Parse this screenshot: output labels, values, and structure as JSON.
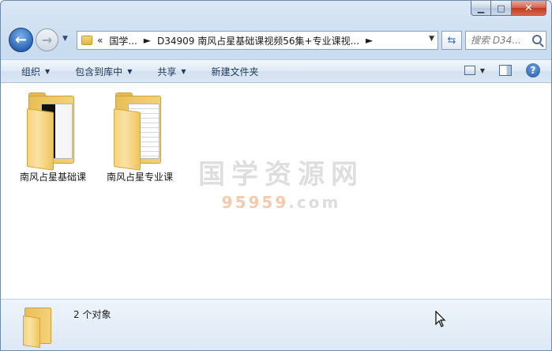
{
  "window": {
    "caption": {
      "minimize": "▁",
      "maximize": "□",
      "close": "✕"
    }
  },
  "nav": {
    "back_icon": "back-arrow-icon",
    "forward_icon": "forward-arrow-icon",
    "address": {
      "prefix": "«",
      "crumbs": [
        "国学...",
        "D34909 南风占星基础课视频56集+专业课视..."
      ],
      "sep": "►"
    },
    "search_placeholder": "搜索 D34..."
  },
  "toolbar": {
    "items": [
      "组织",
      "包含到库中",
      "共享",
      "新建文件夹"
    ]
  },
  "content": {
    "items": [
      {
        "label": "南风占星基础课",
        "type": "folder"
      },
      {
        "label": "南风占星专业课",
        "type": "folder"
      }
    ],
    "watermark": {
      "title": "国学资源网",
      "url_pre": "",
      "url_num": "95959",
      "url_post": ".com"
    }
  },
  "status": {
    "count_text": "2 个对象"
  },
  "colors": {
    "accent": "#2a66b4",
    "folder": "#f3d27a",
    "toolbar_text": "#1e395b"
  }
}
